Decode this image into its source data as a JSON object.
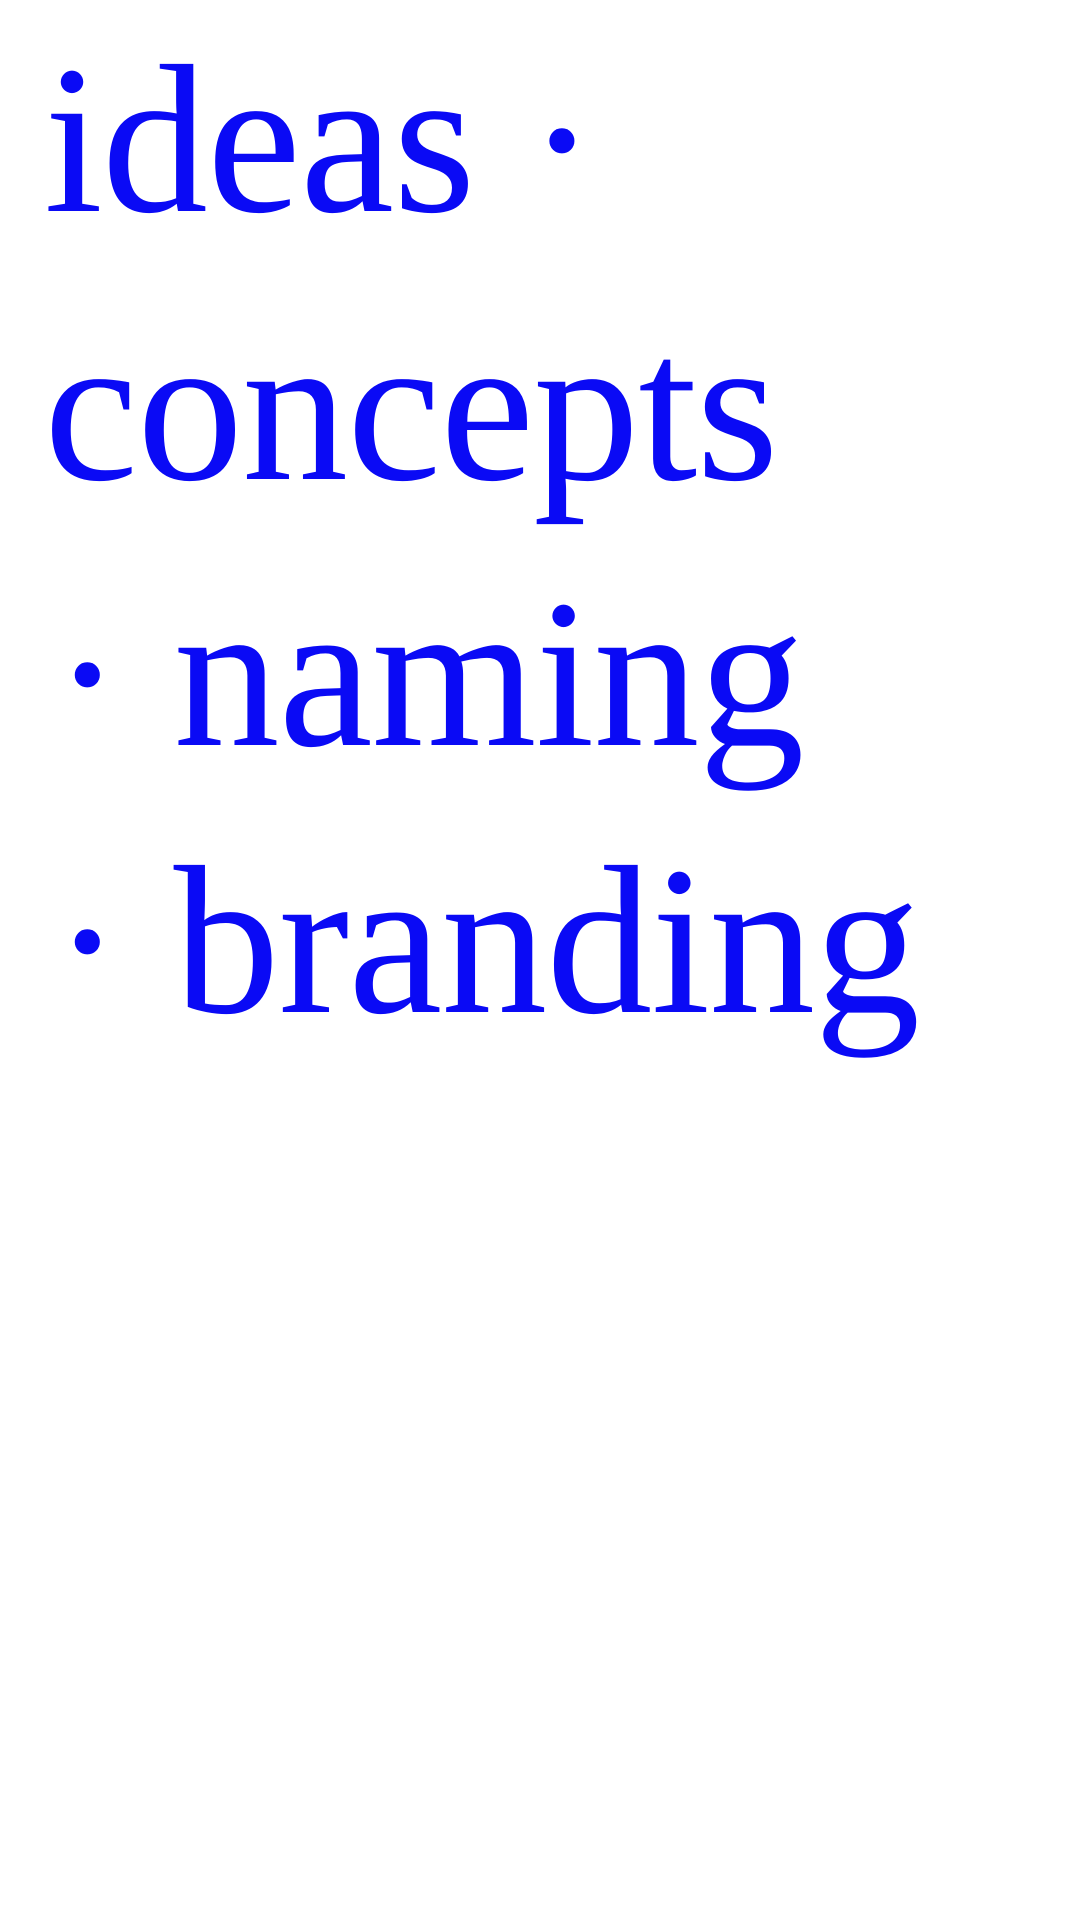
{
  "theme": {
    "text_color": "#0a0af5",
    "background_color": "#ffffff"
  },
  "lines": [
    {
      "text": "ideas ·"
    },
    {
      "text": "concepts"
    },
    {
      "text": "· naming"
    },
    {
      "text": "· branding"
    }
  ]
}
